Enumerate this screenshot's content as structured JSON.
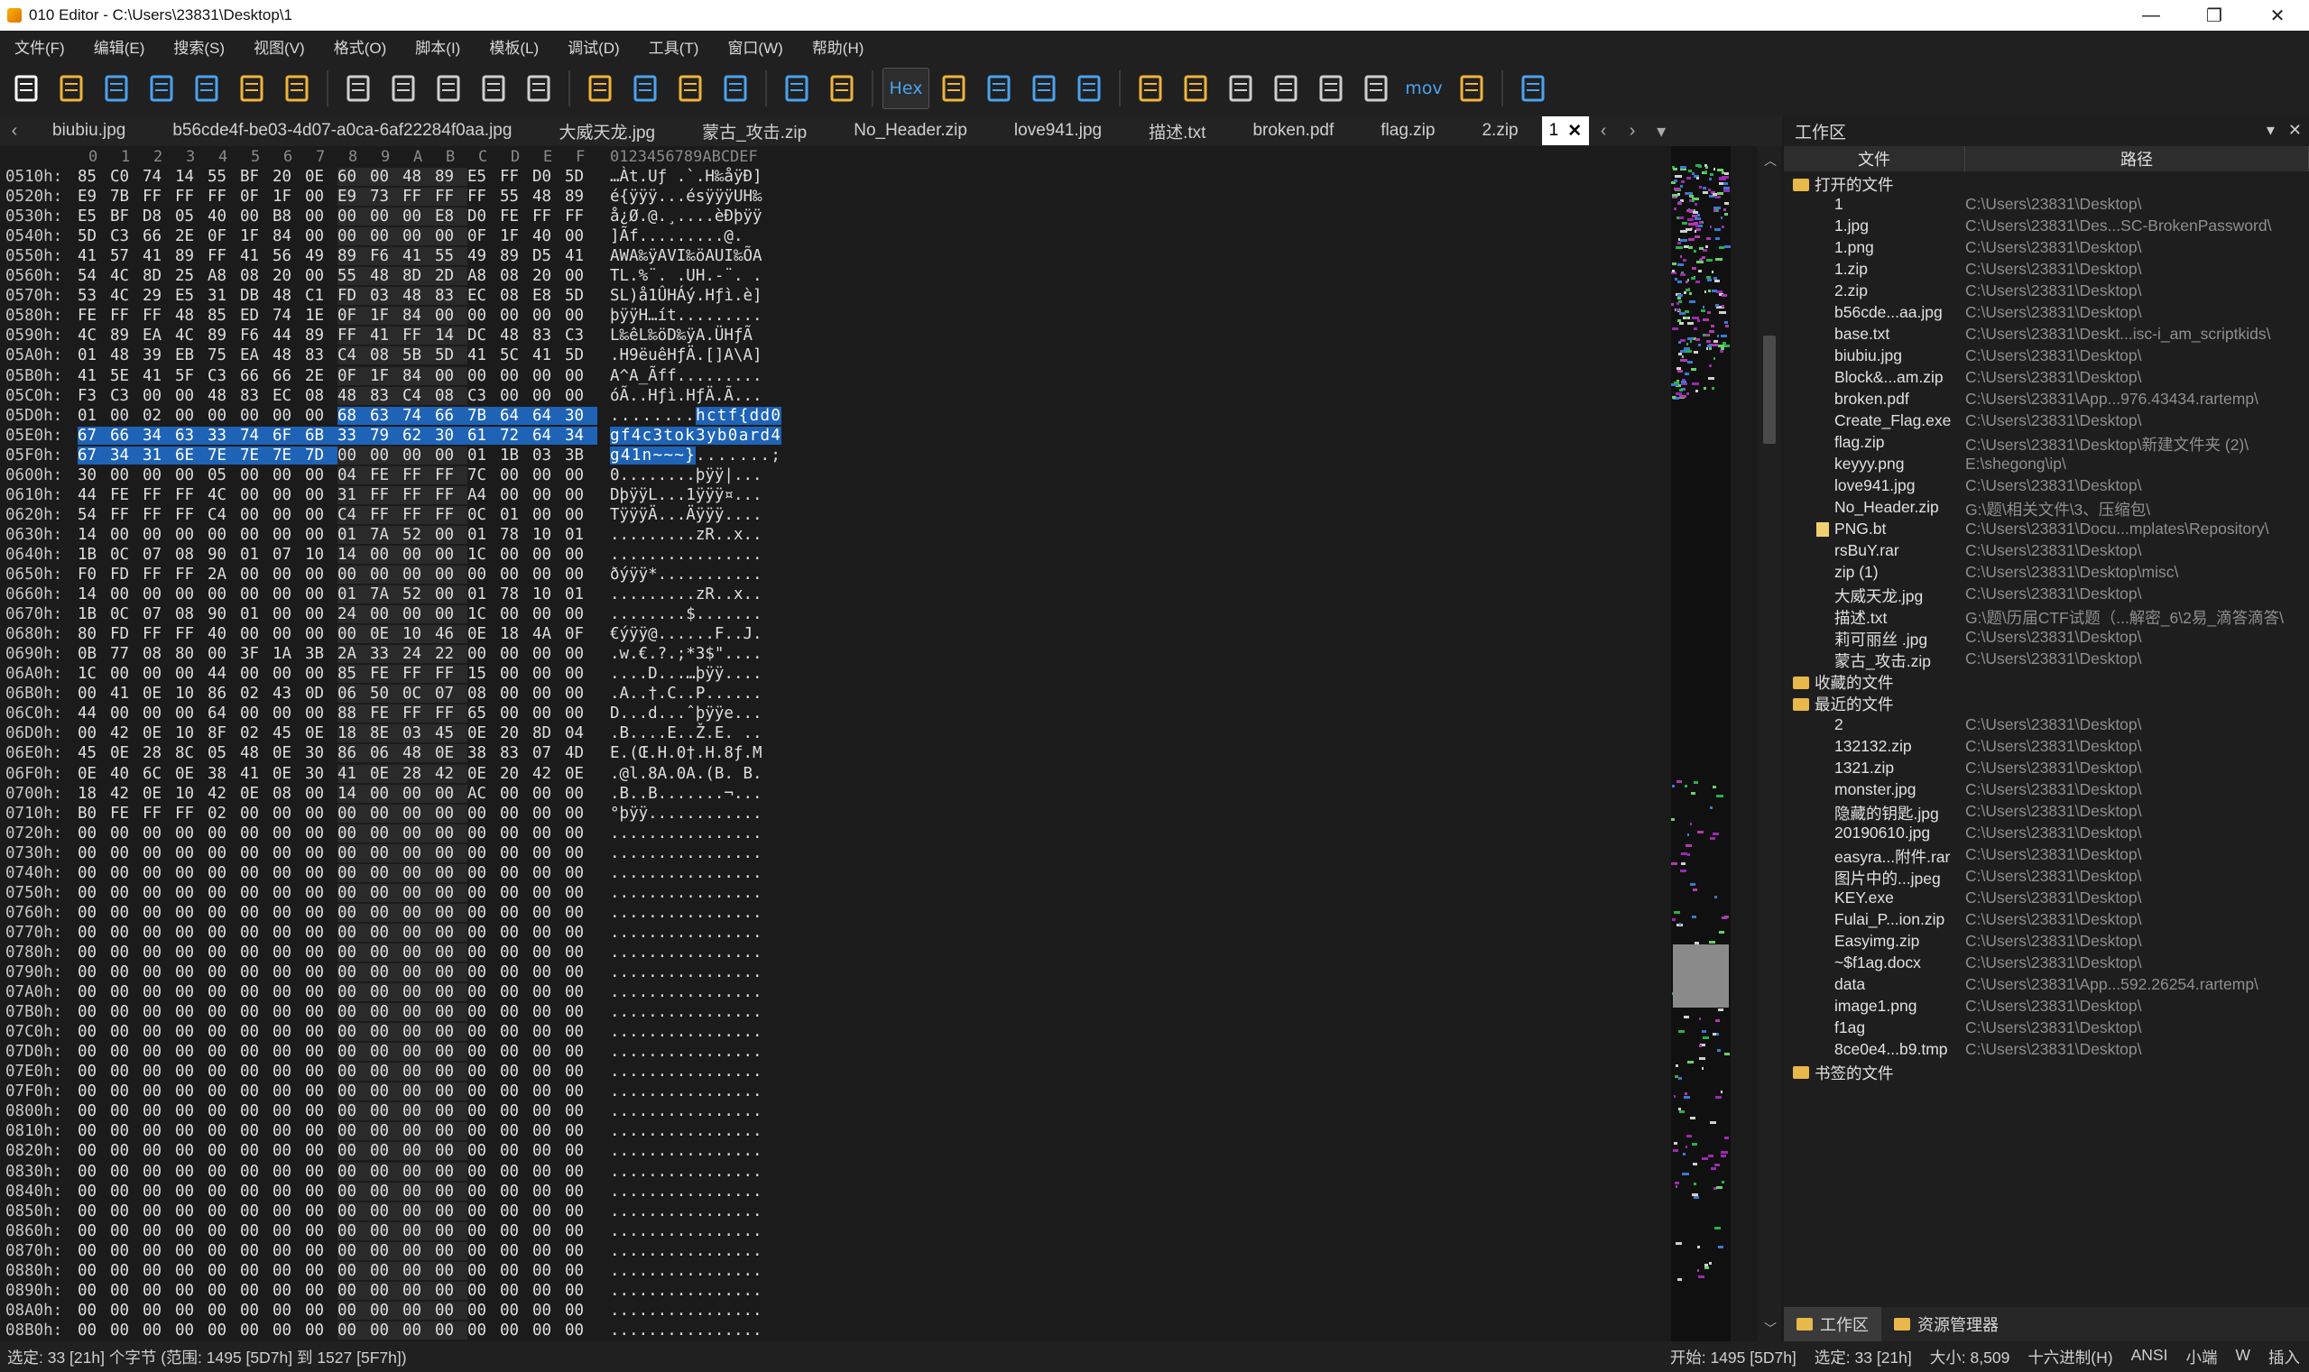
{
  "window": {
    "title": "010 Editor - C:\\Users\\23831\\Desktop\\1",
    "controls": [
      "minimize",
      "maximize",
      "close"
    ]
  },
  "menu": [
    "文件(F)",
    "编辑(E)",
    "搜索(S)",
    "视图(V)",
    "格式(O)",
    "脚本(I)",
    "模板(L)",
    "调试(D)",
    "工具(T)",
    "窗口(W)",
    "帮助(H)"
  ],
  "toolbar": {
    "hex_label": "Hex",
    "mov_label": "mov",
    "icons": [
      "new-file-icon",
      "open-file-icon",
      "save-icon",
      "save-as-icon",
      "save-all-icon",
      "open-folder-icon",
      "workspace-icon",
      "cut-icon",
      "copy-icon",
      "paste-icon",
      "undo-icon",
      "redo-icon",
      "find-icon",
      "replace-icon",
      "find-in-files-icon",
      "goto-icon",
      "run-script-icon",
      "run-template-icon",
      "hex-mode",
      "text-mode-icon",
      "pilcrow-icon",
      "columns-icon",
      "highlight-icon",
      "calculator-icon",
      "inspector-icon",
      "compare-icon",
      "histogram-icon",
      "arithmetic-icon",
      "checksum-icon",
      "mov",
      "base-converter-icon",
      "pause-icon"
    ]
  },
  "tabs": [
    {
      "label": "biubiu.jpg"
    },
    {
      "label": "b56cde4f-be03-4d07-a0ca-6af22284f0aa.jpg"
    },
    {
      "label": "大威天龙.jpg"
    },
    {
      "label": "蒙古_攻击.zip"
    },
    {
      "label": "No_Header.zip"
    },
    {
      "label": "love941.jpg"
    },
    {
      "label": "描述.txt"
    },
    {
      "label": "broken.pdf"
    },
    {
      "label": "flag.zip"
    },
    {
      "label": "2.zip"
    },
    {
      "label": "1",
      "active": true
    }
  ],
  "hex": {
    "col_header": [
      "0",
      "1",
      "2",
      "3",
      "4",
      "5",
      "6",
      "7",
      "8",
      "9",
      "A",
      "B",
      "C",
      "D",
      "E",
      "F"
    ],
    "ascii_header": "0123456789ABCDEF",
    "rows": [
      {
        "addr": "0510h:",
        "bytes": "85 C0 74 14 55 BF 20 0E 60 00 48 89 E5 FF D0 5D",
        "ascii": "…Àt.Uƒ .`.H‰åÿÐ]"
      },
      {
        "addr": "0520h:",
        "bytes": "E9 7B FF FF FF 0F 1F 00 E9 73 FF FF FF 55 48 89",
        "ascii": "é{ÿÿÿ...ésÿÿÿUH‰"
      },
      {
        "addr": "0530h:",
        "bytes": "E5 BF D8 05 40 00 B8 00 00 00 00 E8 D0 FE FF FF",
        "ascii": "å¿Ø.@.¸....èÐþÿÿ"
      },
      {
        "addr": "0540h:",
        "bytes": "5D C3 66 2E 0F 1F 84 00 00 00 00 00 0F 1F 40 00",
        "ascii": "]Ãf.........@."
      },
      {
        "addr": "0550h:",
        "bytes": "41 57 41 89 FF 41 56 49 89 F6 41 55 49 89 D5 41",
        "ascii": "AWA‰ÿAVI‰öAUI‰ÕA"
      },
      {
        "addr": "0560h:",
        "bytes": "54 4C 8D 25 A8 08 20 00 55 48 8D 2D A8 08 20 00",
        "ascii": "TL.%¨. .UH.-¨. ."
      },
      {
        "addr": "0570h:",
        "bytes": "53 4C 29 E5 31 DB 48 C1 FD 03 48 83 EC 08 E8 5D",
        "ascii": "SL)å1ÛHÁý.Hƒì.è]"
      },
      {
        "addr": "0580h:",
        "bytes": "FE FF FF 48 85 ED 74 1E 0F 1F 84 00 00 00 00 00",
        "ascii": "þÿÿH…ít........."
      },
      {
        "addr": "0590h:",
        "bytes": "4C 89 EA 4C 89 F6 44 89 FF 41 FF 14 DC 48 83 C3",
        "ascii": "L‰êL‰öD‰ÿA.ÜHƒÃ"
      },
      {
        "addr": "05A0h:",
        "bytes": "01 48 39 EB 75 EA 48 83 C4 08 5B 5D 41 5C 41 5D",
        "ascii": ".H9ëuêHƒÄ.[]A\\A]"
      },
      {
        "addr": "05B0h:",
        "bytes": "41 5E 41 5F C3 66 66 2E 0F 1F 84 00 00 00 00 00",
        "ascii": "A^A_Ãff........."
      },
      {
        "addr": "05C0h:",
        "bytes": "F3 C3 00 00 48 83 EC 08 48 83 C4 08 C3 00 00 00",
        "ascii": "óÃ..Hƒì.HƒÄ.Ã..."
      },
      {
        "addr": "05D0h:",
        "bytes": "01 00 02 00 00 00 00 00 68 63 74 66 7B 64 64 30",
        "ascii": "........hctf{dd0",
        "sel_from": 8
      },
      {
        "addr": "05E0h:",
        "bytes": "67 66 34 63 33 74 6F 6B 33 79 62 30 61 72 64 34",
        "ascii": "gf4c3tok3yb0ard4",
        "sel_from": 0
      },
      {
        "addr": "05F0h:",
        "bytes": "67 34 31 6E 7E 7E 7E 7D 00 00 00 00 01 1B 03 3B",
        "ascii": "g41n~~~}.......;",
        "sel_from": 0,
        "sel_to": 8
      },
      {
        "addr": "0600h:",
        "bytes": "30 00 00 00 05 00 00 00 04 FE FF FF 7C 00 00 00",
        "ascii": "0........þÿÿ|..."
      },
      {
        "addr": "0610h:",
        "bytes": "44 FE FF FF 4C 00 00 00 31 FF FF FF A4 00 00 00",
        "ascii": "DþÿÿL...1ÿÿÿ¤..."
      },
      {
        "addr": "0620h:",
        "bytes": "54 FF FF FF C4 00 00 00 C4 FF FF FF 0C 01 00 00",
        "ascii": "TÿÿÿÄ...Äÿÿÿ...."
      },
      {
        "addr": "0630h:",
        "bytes": "14 00 00 00 00 00 00 00 01 7A 52 00 01 78 10 01",
        "ascii": ".........zR..x.."
      },
      {
        "addr": "0640h:",
        "bytes": "1B 0C 07 08 90 01 07 10 14 00 00 00 1C 00 00 00",
        "ascii": "................"
      },
      {
        "addr": "0650h:",
        "bytes": "F0 FD FF FF 2A 00 00 00 00 00 00 00 00 00 00 00",
        "ascii": "ðýÿÿ*..........."
      },
      {
        "addr": "0660h:",
        "bytes": "14 00 00 00 00 00 00 00 01 7A 52 00 01 78 10 01",
        "ascii": ".........zR..x.."
      },
      {
        "addr": "0670h:",
        "bytes": "1B 0C 07 08 90 01 00 00 24 00 00 00 1C 00 00 00",
        "ascii": "........$......."
      },
      {
        "addr": "0680h:",
        "bytes": "80 FD FF FF 40 00 00 00 00 0E 10 46 0E 18 4A 0F",
        "ascii": "€ýÿÿ@......F..J."
      },
      {
        "addr": "0690h:",
        "bytes": "0B 77 08 80 00 3F 1A 3B 2A 33 24 22 00 00 00 00",
        "ascii": ".w.€.?.;*3$\"...."
      },
      {
        "addr": "06A0h:",
        "bytes": "1C 00 00 00 44 00 00 00 85 FE FF FF 15 00 00 00",
        "ascii": "....D...…þÿÿ...."
      },
      {
        "addr": "06B0h:",
        "bytes": "00 41 0E 10 86 02 43 0D 06 50 0C 07 08 00 00 00",
        "ascii": ".A..†.C..P......"
      },
      {
        "addr": "06C0h:",
        "bytes": "44 00 00 00 64 00 00 00 88 FE FF FF 65 00 00 00",
        "ascii": "D...d...ˆþÿÿe..."
      },
      {
        "addr": "06D0h:",
        "bytes": "00 42 0E 10 8F 02 45 0E 18 8E 03 45 0E 20 8D 04",
        "ascii": ".B....E..Ž.E. .."
      },
      {
        "addr": "06E0h:",
        "bytes": "45 0E 28 8C 05 48 0E 30 86 06 48 0E 38 83 07 4D",
        "ascii": "E.(Œ.H.0†.H.8ƒ.M"
      },
      {
        "addr": "06F0h:",
        "bytes": "0E 40 6C 0E 38 41 0E 30 41 0E 28 42 0E 20 42 0E",
        "ascii": ".@l.8A.0A.(B. B."
      },
      {
        "addr": "0700h:",
        "bytes": "18 42 0E 10 42 0E 08 00 14 00 00 00 AC 00 00 00",
        "ascii": ".B..B.......¬..."
      },
      {
        "addr": "0710h:",
        "bytes": "B0 FE FF FF 02 00 00 00 00 00 00 00 00 00 00 00",
        "ascii": "°þÿÿ............"
      },
      {
        "addr": "0720h:",
        "bytes": "00 00 00 00 00 00 00 00 00 00 00 00 00 00 00 00",
        "ascii": "................"
      },
      {
        "addr": "0730h:",
        "bytes": "00 00 00 00 00 00 00 00 00 00 00 00 00 00 00 00",
        "ascii": "................"
      },
      {
        "addr": "0740h:",
        "bytes": "00 00 00 00 00 00 00 00 00 00 00 00 00 00 00 00",
        "ascii": "................"
      },
      {
        "addr": "0750h:",
        "bytes": "00 00 00 00 00 00 00 00 00 00 00 00 00 00 00 00",
        "ascii": "................"
      },
      {
        "addr": "0760h:",
        "bytes": "00 00 00 00 00 00 00 00 00 00 00 00 00 00 00 00",
        "ascii": "................"
      },
      {
        "addr": "0770h:",
        "bytes": "00 00 00 00 00 00 00 00 00 00 00 00 00 00 00 00",
        "ascii": "................"
      },
      {
        "addr": "0780h:",
        "bytes": "00 00 00 00 00 00 00 00 00 00 00 00 00 00 00 00",
        "ascii": "................"
      },
      {
        "addr": "0790h:",
        "bytes": "00 00 00 00 00 00 00 00 00 00 00 00 00 00 00 00",
        "ascii": "................"
      },
      {
        "addr": "07A0h:",
        "bytes": "00 00 00 00 00 00 00 00 00 00 00 00 00 00 00 00",
        "ascii": "................"
      },
      {
        "addr": "07B0h:",
        "bytes": "00 00 00 00 00 00 00 00 00 00 00 00 00 00 00 00",
        "ascii": "................"
      },
      {
        "addr": "07C0h:",
        "bytes": "00 00 00 00 00 00 00 00 00 00 00 00 00 00 00 00",
        "ascii": "................"
      },
      {
        "addr": "07D0h:",
        "bytes": "00 00 00 00 00 00 00 00 00 00 00 00 00 00 00 00",
        "ascii": "................"
      },
      {
        "addr": "07E0h:",
        "bytes": "00 00 00 00 00 00 00 00 00 00 00 00 00 00 00 00",
        "ascii": "................"
      },
      {
        "addr": "07F0h:",
        "bytes": "00 00 00 00 00 00 00 00 00 00 00 00 00 00 00 00",
        "ascii": "................"
      },
      {
        "addr": "0800h:",
        "bytes": "00 00 00 00 00 00 00 00 00 00 00 00 00 00 00 00",
        "ascii": "................"
      },
      {
        "addr": "0810h:",
        "bytes": "00 00 00 00 00 00 00 00 00 00 00 00 00 00 00 00",
        "ascii": "................"
      },
      {
        "addr": "0820h:",
        "bytes": "00 00 00 00 00 00 00 00 00 00 00 00 00 00 00 00",
        "ascii": "................"
      },
      {
        "addr": "0830h:",
        "bytes": "00 00 00 00 00 00 00 00 00 00 00 00 00 00 00 00",
        "ascii": "................"
      },
      {
        "addr": "0840h:",
        "bytes": "00 00 00 00 00 00 00 00 00 00 00 00 00 00 00 00",
        "ascii": "................"
      },
      {
        "addr": "0850h:",
        "bytes": "00 00 00 00 00 00 00 00 00 00 00 00 00 00 00 00",
        "ascii": "................"
      },
      {
        "addr": "0860h:",
        "bytes": "00 00 00 00 00 00 00 00 00 00 00 00 00 00 00 00",
        "ascii": "................"
      },
      {
        "addr": "0870h:",
        "bytes": "00 00 00 00 00 00 00 00 00 00 00 00 00 00 00 00",
        "ascii": "................"
      },
      {
        "addr": "0880h:",
        "bytes": "00 00 00 00 00 00 00 00 00 00 00 00 00 00 00 00",
        "ascii": "................"
      },
      {
        "addr": "0890h:",
        "bytes": "00 00 00 00 00 00 00 00 00 00 00 00 00 00 00 00",
        "ascii": "................"
      },
      {
        "addr": "08A0h:",
        "bytes": "00 00 00 00 00 00 00 00 00 00 00 00 00 00 00 00",
        "ascii": "................"
      },
      {
        "addr": "08B0h:",
        "bytes": "00 00 00 00 00 00 00 00 00 00 00 00 00 00 00 00",
        "ascii": "................"
      }
    ]
  },
  "workspace": {
    "title": "工作区",
    "col_file": "文件",
    "col_path": "路径",
    "groups": [
      {
        "label": "打开的文件",
        "files": [
          {
            "name": "1",
            "path": "C:\\Users\\23831\\Desktop\\"
          },
          {
            "name": "1.jpg",
            "path": "C:\\Users\\23831\\Des...SC-BrokenPassword\\"
          },
          {
            "name": "1.png",
            "path": "C:\\Users\\23831\\Desktop\\"
          },
          {
            "name": "1.zip",
            "path": "C:\\Users\\23831\\Desktop\\"
          },
          {
            "name": "2.zip",
            "path": "C:\\Users\\23831\\Desktop\\"
          },
          {
            "name": "b56cde...aa.jpg",
            "path": "C:\\Users\\23831\\Desktop\\"
          },
          {
            "name": "base.txt",
            "path": "C:\\Users\\23831\\Deskt...isc-i_am_scriptkids\\"
          },
          {
            "name": "biubiu.jpg",
            "path": "C:\\Users\\23831\\Desktop\\"
          },
          {
            "name": "Block&...am.zip",
            "path": "C:\\Users\\23831\\Desktop\\"
          },
          {
            "name": "broken.pdf",
            "path": "C:\\Users\\23831\\App...976.43434.rartemp\\"
          },
          {
            "name": "Create_Flag.exe",
            "path": "C:\\Users\\23831\\Desktop\\"
          },
          {
            "name": "flag.zip",
            "path": "C:\\Users\\23831\\Desktop\\新建文件夹 (2)\\"
          },
          {
            "name": "keyyy.png",
            "path": "E:\\shegong\\ip\\"
          },
          {
            "name": "love941.jpg",
            "path": "C:\\Users\\23831\\Desktop\\"
          },
          {
            "name": "No_Header.zip",
            "path": "G:\\题\\相关文件\\3、压缩包\\"
          },
          {
            "name": "PNG.bt",
            "path": "C:\\Users\\23831\\Docu...mplates\\Repository\\",
            "icon": true
          },
          {
            "name": "rsBuY.rar",
            "path": "C:\\Users\\23831\\Desktop\\"
          },
          {
            "name": "zip (1)",
            "path": "C:\\Users\\23831\\Desktop\\misc\\"
          },
          {
            "name": "大威天龙.jpg",
            "path": "C:\\Users\\23831\\Desktop\\"
          },
          {
            "name": "描述.txt",
            "path": "G:\\题\\历届CTF试题（...解密_6\\2易_滴答滴答\\"
          },
          {
            "name": "莉可丽丝 .jpg",
            "path": "C:\\Users\\23831\\Desktop\\"
          },
          {
            "name": "蒙古_攻击.zip",
            "path": "C:\\Users\\23831\\Desktop\\"
          }
        ]
      },
      {
        "label": "收藏的文件",
        "files": []
      },
      {
        "label": "最近的文件",
        "files": [
          {
            "name": "2",
            "path": "C:\\Users\\23831\\Desktop\\"
          },
          {
            "name": "132132.zip",
            "path": "C:\\Users\\23831\\Desktop\\"
          },
          {
            "name": "1321.zip",
            "path": "C:\\Users\\23831\\Desktop\\"
          },
          {
            "name": "monster.jpg",
            "path": "C:\\Users\\23831\\Desktop\\"
          },
          {
            "name": "隐藏的钥匙.jpg",
            "path": "C:\\Users\\23831\\Desktop\\"
          },
          {
            "name": "20190610.jpg",
            "path": "C:\\Users\\23831\\Desktop\\"
          },
          {
            "name": "easyra...附件.rar",
            "path": "C:\\Users\\23831\\Desktop\\"
          },
          {
            "name": "图片中的...jpeg",
            "path": "C:\\Users\\23831\\Desktop\\"
          },
          {
            "name": "KEY.exe",
            "path": "C:\\Users\\23831\\Desktop\\"
          },
          {
            "name": "Fulai_P...ion.zip",
            "path": "C:\\Users\\23831\\Desktop\\"
          },
          {
            "name": "Easyimg.zip",
            "path": "C:\\Users\\23831\\Desktop\\"
          },
          {
            "name": "~$f1ag.docx",
            "path": "C:\\Users\\23831\\Desktop\\"
          },
          {
            "name": "data",
            "path": "C:\\Users\\23831\\App...592.26254.rartemp\\"
          },
          {
            "name": "image1.png",
            "path": "C:\\Users\\23831\\Desktop\\"
          },
          {
            "name": "f1ag",
            "path": "C:\\Users\\23831\\Desktop\\"
          },
          {
            "name": "8ce0e4...b9.tmp",
            "path": "C:\\Users\\23831\\Desktop\\"
          }
        ]
      },
      {
        "label": "书签的文件",
        "files": []
      }
    ],
    "bottom_tabs": [
      "工作区",
      "资源管理器"
    ]
  },
  "status": {
    "left": "选定: 33 [21h] 个字节 (范围: 1495 [5D7h] 到 1527 [5F7h])",
    "start": "开始: 1495 [5D7h]",
    "selected": "选定: 33 [21h]",
    "size": "大小: 8,509",
    "mode": "十六进制(H)",
    "encoding": "ANSI",
    "endian": "小端",
    "w": "W",
    "insert": "插入"
  }
}
